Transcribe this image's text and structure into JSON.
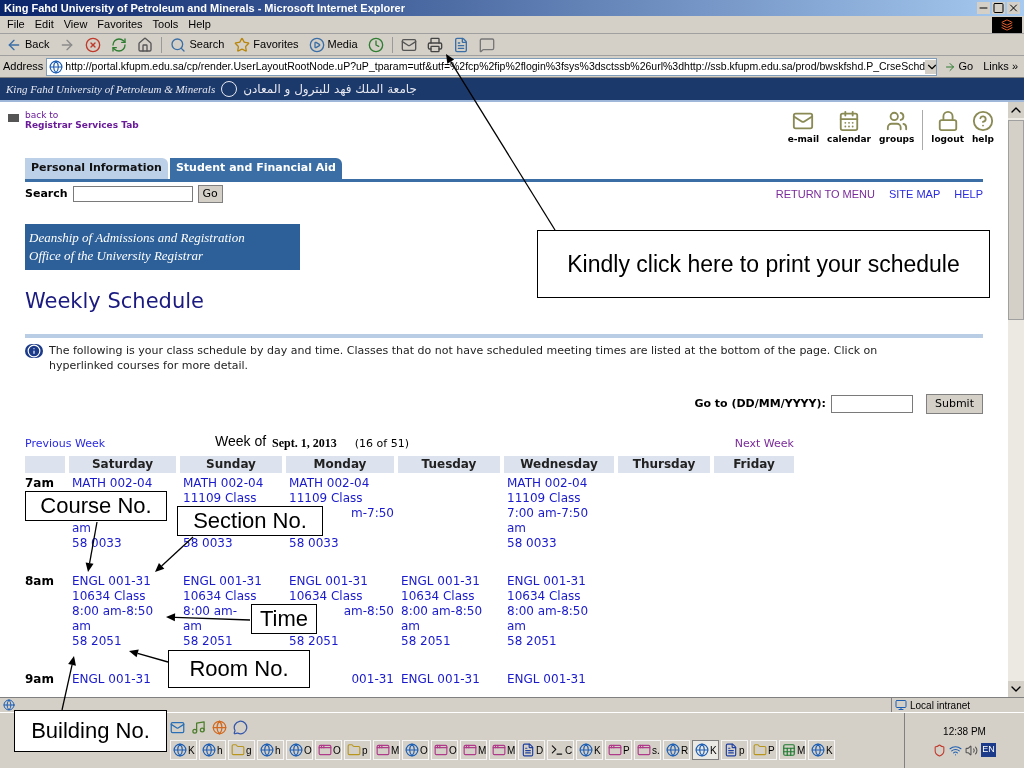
{
  "window": {
    "title": "King Fahd University of Petroleum and Minerals - Microsoft Internet Explorer"
  },
  "menu": [
    "File",
    "Edit",
    "View",
    "Favorites",
    "Tools",
    "Help"
  ],
  "toolbar": [
    {
      "kind": "back",
      "label": "Back"
    },
    {
      "kind": "forward"
    },
    {
      "kind": "stop"
    },
    {
      "kind": "refresh"
    },
    {
      "kind": "home"
    },
    {
      "kind": "search",
      "label": "Search"
    },
    {
      "kind": "favorites",
      "label": "Favorites"
    },
    {
      "kind": "media",
      "label": "Media"
    },
    {
      "kind": "history"
    },
    {
      "kind": "mail"
    },
    {
      "kind": "print"
    },
    {
      "kind": "edit"
    },
    {
      "kind": "discuss"
    }
  ],
  "address": {
    "label": "Address",
    "url": "http://portal.kfupm.edu.sa/cp/render.UserLayoutRootNode.uP?uP_tparam=utf&utf=%2fcp%2fip%2flogin%3fsys%3dsctssb%26url%3dhttp://ssb.kfupm.edu.sa/prod/bwskfshd.P_CrseSchd",
    "go": "Go",
    "links": "Links »"
  },
  "portal_banner": {
    "name_en": "King Fahd University of Petroleum & Minerals",
    "name_ar": "جامعة الملك فهد للبترول و المعادن"
  },
  "back_link": {
    "line1": "back to",
    "line2": "Registrar Services Tab"
  },
  "portal_tools": [
    {
      "kind": "mail",
      "label": "e-mail"
    },
    {
      "kind": "calendar",
      "label": "calendar"
    },
    {
      "kind": "groups",
      "label": "groups"
    },
    {
      "kind": "lock",
      "label": "logout"
    },
    {
      "kind": "help",
      "label": "help"
    }
  ],
  "tabs": [
    {
      "label": "Personal Information",
      "selected": false
    },
    {
      "label": "Student and Financial Aid",
      "selected": true
    }
  ],
  "search": {
    "label": "Search",
    "button": "Go"
  },
  "top_links": [
    {
      "label": "RETURN TO MENU",
      "visited": true
    },
    {
      "label": "SITE MAP",
      "visited": false
    },
    {
      "label": "HELP",
      "visited": false
    }
  ],
  "dept_banner": [
    "Deanship of Admissions and Registration",
    "Office of the University Registrar"
  ],
  "page_title": "Weekly Schedule",
  "info": "The following is your class schedule by day and time. Classes that do not have scheduled meeting times are listed at the bottom of the page. Click on hyperlinked courses for more detail.",
  "goto": {
    "label": "Go to (DD/MM/YYYY):",
    "button": "Submit"
  },
  "week_nav": {
    "previous": {
      "label": "Previous Week",
      "visited": false
    },
    "week_label": "Week of",
    "date": "Sept. 1, 2013",
    "count": "(16 of 51)",
    "next": {
      "label": "Next Week",
      "visited": true
    }
  },
  "days": [
    "Saturday",
    "Sunday",
    "Monday",
    "Tuesday",
    "Wednesday",
    "Thursday",
    "Friday"
  ],
  "rows": [
    {
      "time": "7am",
      "cells": [
        [
          {
            "kind": "start",
            "text": "MATH 002-04"
          },
          {
            "kind": "covered"
          },
          {
            "kind": "covered"
          },
          {
            "kind": "start",
            "text": "am"
          },
          {
            "kind": "start",
            "text": "58 0033"
          }
        ],
        [
          {
            "kind": "start",
            "text": "MATH 002-04"
          },
          {
            "kind": "start",
            "text": "11109 Class"
          },
          {
            "kind": "covered"
          },
          {
            "kind": "covered"
          },
          {
            "kind": "start",
            "text": "58 0033"
          }
        ],
        [
          {
            "kind": "start",
            "text": "MATH 002-04"
          },
          {
            "kind": "start",
            "text": "11109 Class"
          },
          {
            "kind": "end",
            "text": "m-7:50"
          },
          {
            "kind": "covered"
          },
          {
            "kind": "start",
            "text": "58 0033"
          }
        ],
        [],
        [
          {
            "kind": "start",
            "text": "MATH 002-04"
          },
          {
            "kind": "start",
            "text": "11109 Class"
          },
          {
            "kind": "start",
            "text": "7:00 am-7:50"
          },
          {
            "kind": "start",
            "text": "am"
          },
          {
            "kind": "start",
            "text": "58 0033"
          }
        ],
        [],
        []
      ]
    },
    {
      "time": "8am",
      "cells": [
        [
          {
            "kind": "start",
            "text": "ENGL 001-31"
          },
          {
            "kind": "start",
            "text": "10634 Class"
          },
          {
            "kind": "start",
            "text": "8:00 am-8:50"
          },
          {
            "kind": "start",
            "text": "am"
          },
          {
            "kind": "start",
            "text": "58 2051"
          }
        ],
        [
          {
            "kind": "start",
            "text": "ENGL 001-31"
          },
          {
            "kind": "start",
            "text": "10634 Class"
          },
          {
            "kind": "start",
            "text": "8:00 am-"
          },
          {
            "kind": "start",
            "text": "am"
          },
          {
            "kind": "start",
            "text": "58 2051"
          }
        ],
        [
          {
            "kind": "start",
            "text": "ENGL 001-31"
          },
          {
            "kind": "start",
            "text": "10634 Class"
          },
          {
            "kind": "end",
            "text": "am-8:50"
          },
          {
            "kind": "covered"
          },
          {
            "kind": "start",
            "text": "58 2051"
          }
        ],
        [
          {
            "kind": "start",
            "text": "ENGL 001-31"
          },
          {
            "kind": "start",
            "text": "10634 Class"
          },
          {
            "kind": "start",
            "text": "8:00 am-8:50"
          },
          {
            "kind": "start",
            "text": "am"
          },
          {
            "kind": "start",
            "text": "58 2051"
          }
        ],
        [
          {
            "kind": "start",
            "text": "ENGL 001-31"
          },
          {
            "kind": "start",
            "text": "10634 Class"
          },
          {
            "kind": "start",
            "text": "8:00 am-8:50"
          },
          {
            "kind": "start",
            "text": "am"
          },
          {
            "kind": "start",
            "text": "58 2051"
          }
        ],
        [],
        []
      ]
    },
    {
      "time": "9am",
      "cells": [
        [
          {
            "kind": "start",
            "text": "ENGL 001-31"
          }
        ],
        [
          {
            "kind": "covered"
          }
        ],
        [
          {
            "kind": "end",
            "text": "001-31"
          }
        ],
        [
          {
            "kind": "start",
            "text": "ENGL 001-31"
          }
        ],
        [
          {
            "kind": "start",
            "text": "ENGL 001-31"
          }
        ],
        [],
        []
      ]
    }
  ],
  "callouts": [
    {
      "text": "Kindly click here to print your schedule"
    },
    {
      "text": "Course No."
    },
    {
      "text": "Section No."
    },
    {
      "text": "Time"
    },
    {
      "text": "Room No."
    },
    {
      "text": "Building No."
    }
  ],
  "status_bar": {
    "zone": "Local intranet"
  },
  "taskbar": {
    "quick_launch": [
      {
        "kind": "mail"
      },
      {
        "kind": "media"
      },
      {
        "kind": "browser"
      },
      {
        "kind": "chat"
      }
    ],
    "tasks": [
      {
        "kind": "ie",
        "letter": "K",
        "selected": false
      },
      {
        "kind": "ie",
        "letter": "h",
        "selected": false
      },
      {
        "kind": "folder",
        "letter": "g",
        "selected": false
      },
      {
        "kind": "ie",
        "letter": "h",
        "selected": false
      },
      {
        "kind": "ie",
        "letter": "O",
        "selected": false
      },
      {
        "kind": "app",
        "letter": "O",
        "selected": false
      },
      {
        "kind": "folder",
        "letter": "p",
        "selected": false
      },
      {
        "kind": "app",
        "letter": "M",
        "selected": false
      },
      {
        "kind": "ie",
        "letter": "O",
        "selected": false
      },
      {
        "kind": "app",
        "letter": "O",
        "selected": false
      },
      {
        "kind": "app",
        "letter": "M",
        "selected": false
      },
      {
        "kind": "app",
        "letter": "M",
        "selected": false
      },
      {
        "kind": "word",
        "letter": "D",
        "selected": false
      },
      {
        "kind": "console",
        "letter": "C",
        "selected": false
      },
      {
        "kind": "ie",
        "letter": "K",
        "selected": false
      },
      {
        "kind": "app",
        "letter": "P",
        "selected": false
      },
      {
        "kind": "app",
        "letter": "s.",
        "selected": false
      },
      {
        "kind": "ie",
        "letter": "R",
        "selected": false
      },
      {
        "kind": "ie",
        "letter": "K",
        "selected": true
      },
      {
        "kind": "word",
        "letter": "p",
        "selected": false
      },
      {
        "kind": "folder",
        "letter": "P",
        "selected": false
      },
      {
        "kind": "excel",
        "letter": "M",
        "selected": false
      },
      {
        "kind": "ie",
        "letter": "K",
        "selected": false
      }
    ],
    "clock": "12:38 PM",
    "language": "EN"
  }
}
